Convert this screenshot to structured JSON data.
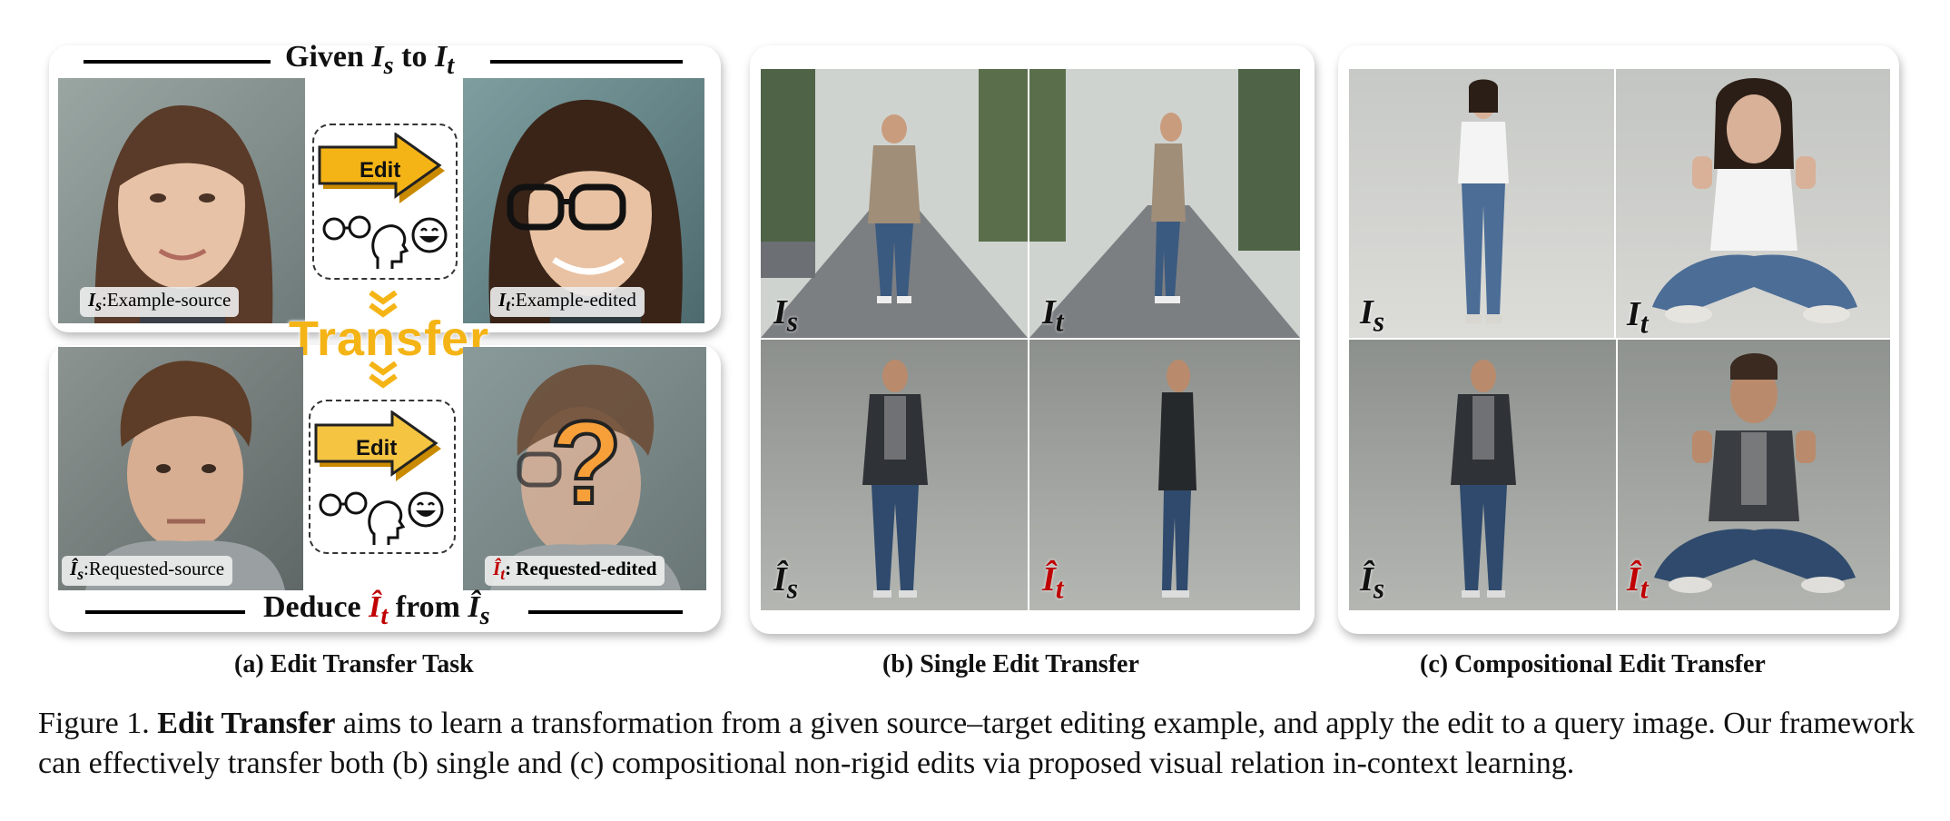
{
  "panel_a": {
    "top_heading": {
      "prefix": "Given ",
      "s1": "I",
      "sub1": "s",
      "mid": " to ",
      "s2": "I",
      "sub2": "t"
    },
    "bottom_heading": {
      "prefix": "Deduce ",
      "s1": "Î",
      "sub1": "t",
      "mid": " from ",
      "s2": "Î",
      "sub2": "s"
    },
    "label_example_source": {
      "sym": "I",
      "sub": "s",
      "text": ":Example-source"
    },
    "label_example_edited": {
      "sym": "I",
      "sub": "t",
      "text": ":Example-edited"
    },
    "label_requested_source": {
      "sym": "Î",
      "sub": "s",
      "text": ":Requested-source"
    },
    "label_requested_edited": {
      "sym": "Î",
      "sub": "t",
      "text": ": Requested-edited"
    },
    "edit_label_top": "Edit",
    "edit_label_bottom": "Edit",
    "transfer_word": "Transfer",
    "question_mark": "?",
    "subcaption": "(a) Edit Transfer Task"
  },
  "panel_b": {
    "syms": {
      "is": "I",
      "is_sub": "s",
      "it": "I",
      "it_sub": "t",
      "his": "Î",
      "his_sub": "s",
      "hit": "Î",
      "hit_sub": "t"
    },
    "subcaption": "(b) Single Edit Transfer"
  },
  "panel_c": {
    "syms": {
      "is": "I",
      "is_sub": "s",
      "it": "I",
      "it_sub": "t",
      "his": "Î",
      "his_sub": "s",
      "hit": "Î",
      "hit_sub": "t"
    },
    "subcaption": "(c) Compositional Edit Transfer"
  },
  "caption": {
    "lead": "Figure 1. ",
    "bold": "Edit Transfer",
    "rest": " aims to learn a transformation from a given source–target editing example, and apply the edit to a query image. Our framework can effectively transfer both (b) single and (c) compositional non-rigid edits via proposed visual relation in-context learning."
  },
  "colors": {
    "accent_yellow": "#f5b416",
    "red": "#c00000"
  }
}
